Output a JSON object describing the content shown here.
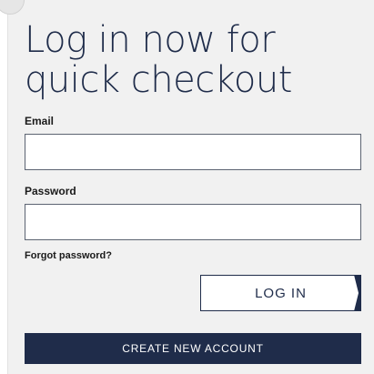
{
  "login": {
    "title": "Log in now for quick checkout",
    "email_label": "Email",
    "email_value": "",
    "password_label": "Password",
    "password_value": "",
    "forgot_password": "Forgot password?",
    "login_button": "LOG IN",
    "create_account_button": "CREATE NEW ACCOUNT"
  },
  "colors": {
    "brand_navy": "#1f2c4a",
    "panel_background": "#f1f1f1"
  }
}
